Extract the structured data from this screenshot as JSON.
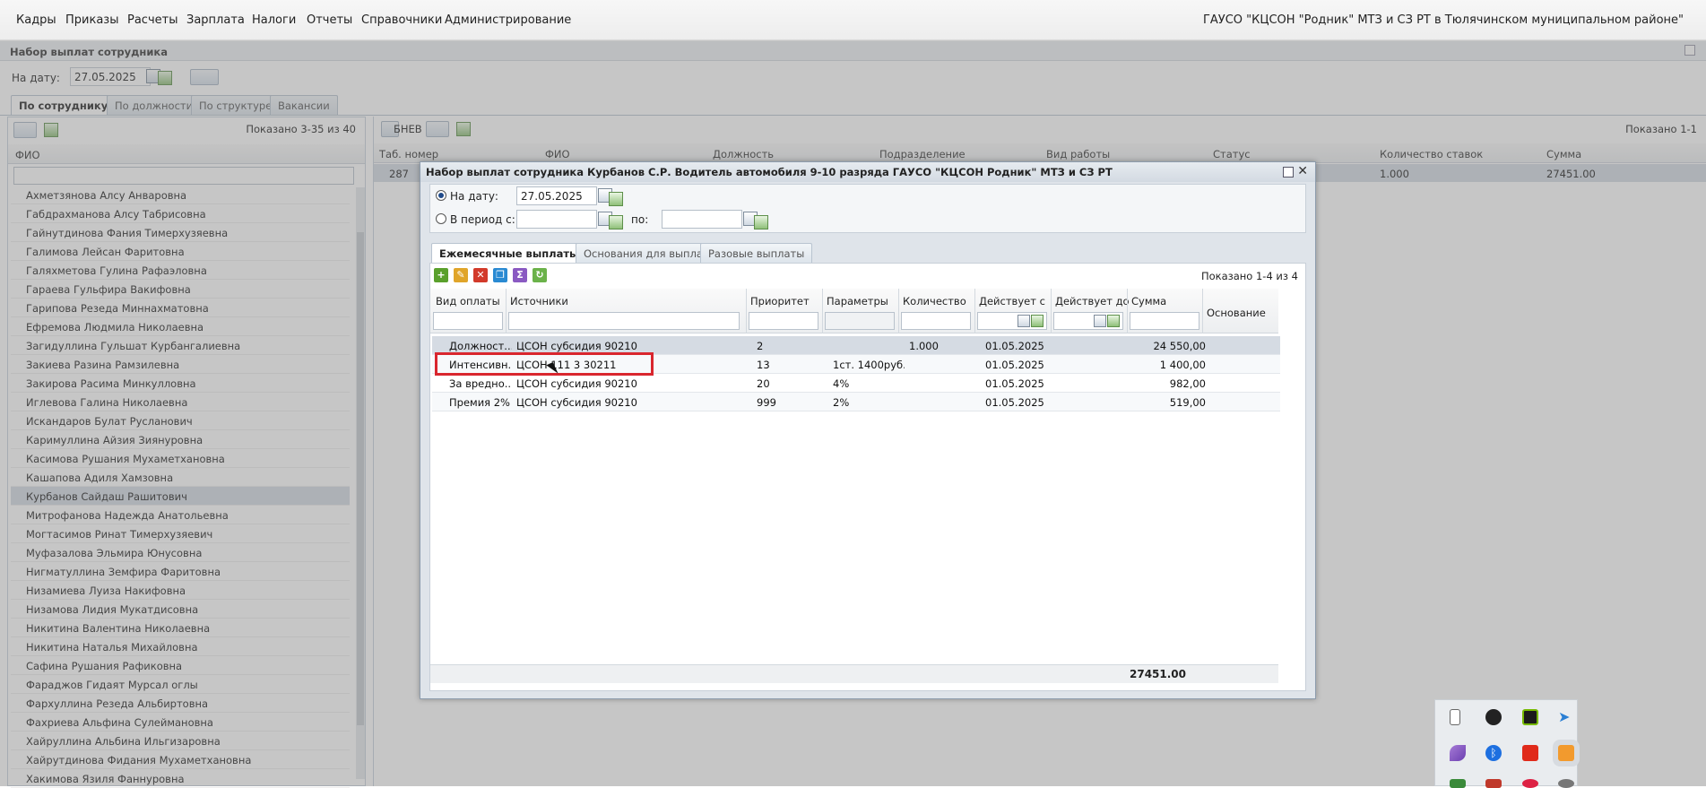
{
  "menu": {
    "items": [
      "Кадры",
      "Приказы",
      "Расчеты",
      "Зарплата",
      "Налоги",
      "Отчеты",
      "Справочники",
      "Администрирование"
    ],
    "org": "ГАУСО \"КЦСОН \"Родник\" МТЗ и СЗ РТ в Тюлячинском муниципальном районе\""
  },
  "page": {
    "title": "Набор выплат сотрудника",
    "date_label": "На дату:",
    "date_value": "27.05.2025",
    "tabs": [
      "По сотруднику",
      "По должности",
      "По структуре",
      "Вакансии"
    ]
  },
  "left_panel": {
    "shown": "Показано 3-35 из 40",
    "column": "ФИО",
    "employees": [
      "Ахметзянова Алсу Анваровна",
      "Габдрахманова Алсу Табрисовна",
      "Гайнутдинова Фания Тимерхузяевна",
      "Галимова Лейсан Фаритовна",
      "Галяхметова Гулина Рафаэловна",
      "Гараева Гульфира Вакифовна",
      "Гарипова Резеда Миннахматовна",
      "Ефремова Людмила Николаевна",
      "Загидуллина Гульшат Курбангалиевна",
      "Закиева Разина Рамзилевна",
      "Закирова Расима Минкулловна",
      "Иглевова Галина Николаевна",
      "Искандаров Булат Русланович",
      "Каримуллина Айзия Зиянуровна",
      "Касимова Рушания Мухаметхановна",
      "Кашапова Адиля Хамзовна",
      "Курбанов Сайдаш Рашитович",
      "Митрофанова Надежда Анатольевна",
      "Могтасимов Ринат Тимерхузяевич",
      "Муфазалова Эльмира Юнусовна",
      "Нигматуллина Земфира Фаритовна",
      "Низамиева Луиза Накифовна",
      "Низамова Лидия Мукатдисовна",
      "Никитина Валентина Николаевна",
      "Никитина Наталья Михайловна",
      "Сафина Рушания Рафиковна",
      "Фараджов Гидаят Мурсал оглы",
      "Фархуллина Резеда Альбиртовна",
      "Фахриева Альфина Сулеймановна",
      "Хайруллина Альбина Ильгизаровна",
      "Хайрутдинова Фидания Мухаметхановна",
      "Хакимова Язиля Фаннуровна"
    ],
    "selected_index": 16
  },
  "right_panel": {
    "bnev": "БНЕВ",
    "shown": "Показано 1-1",
    "columns": [
      "Таб. номер",
      "ФИО",
      "Должность",
      "Подразделение",
      "Вид работы",
      "Статус",
      "Количество ставок",
      "Сумма"
    ],
    "row": {
      "tab": "287",
      "rate": "1.000",
      "sum": "27451.00"
    }
  },
  "dialog": {
    "title": "Набор выплат сотрудника Курбанов С.Р. Водитель автомобиля 9-10 разряда ГАУСО \"КЦСОН Родник\" МТЗ и СЗ РТ",
    "on_date_label": "На дату:",
    "on_date_value": "27.05.2025",
    "period_label": "В период с:",
    "to_label": "по:",
    "tabs": [
      "Ежемесячные выплаты",
      "Основания для выплат",
      "Разовые выплаты"
    ],
    "shown": "Показано 1-4 из 4",
    "columns": [
      "Вид оплаты",
      "Источники",
      "Приоритет",
      "Параметры",
      "Количество ...",
      "Действует с",
      "Действует до",
      "Сумма",
      "Основание"
    ],
    "rows": [
      {
        "type": "Должност...",
        "source": "ЦСОН субсидия 90210",
        "priority": "2",
        "params": "",
        "qty": "1.000",
        "from": "01.05.2025",
        "to": "",
        "sum": "24 550,00",
        "basis": ""
      },
      {
        "type": "Интенсивн...",
        "source": "ЦСОН 111 3 30211",
        "priority": "13",
        "params": "1ст. 1400руб.",
        "qty": "",
        "from": "01.05.2025",
        "to": "",
        "sum": "1 400,00",
        "basis": ""
      },
      {
        "type": "За вредно...",
        "source": "ЦСОН субсидия 90210",
        "priority": "20",
        "params": "4%",
        "qty": "",
        "from": "01.05.2025",
        "to": "",
        "sum": "982,00",
        "basis": ""
      },
      {
        "type": "Премия 2%",
        "source": "ЦСОН субсидия 90210",
        "priority": "999",
        "params": "2%",
        "qty": "",
        "from": "01.05.2025",
        "to": "",
        "sum": "519,00",
        "basis": ""
      }
    ],
    "total": "27451.00"
  }
}
